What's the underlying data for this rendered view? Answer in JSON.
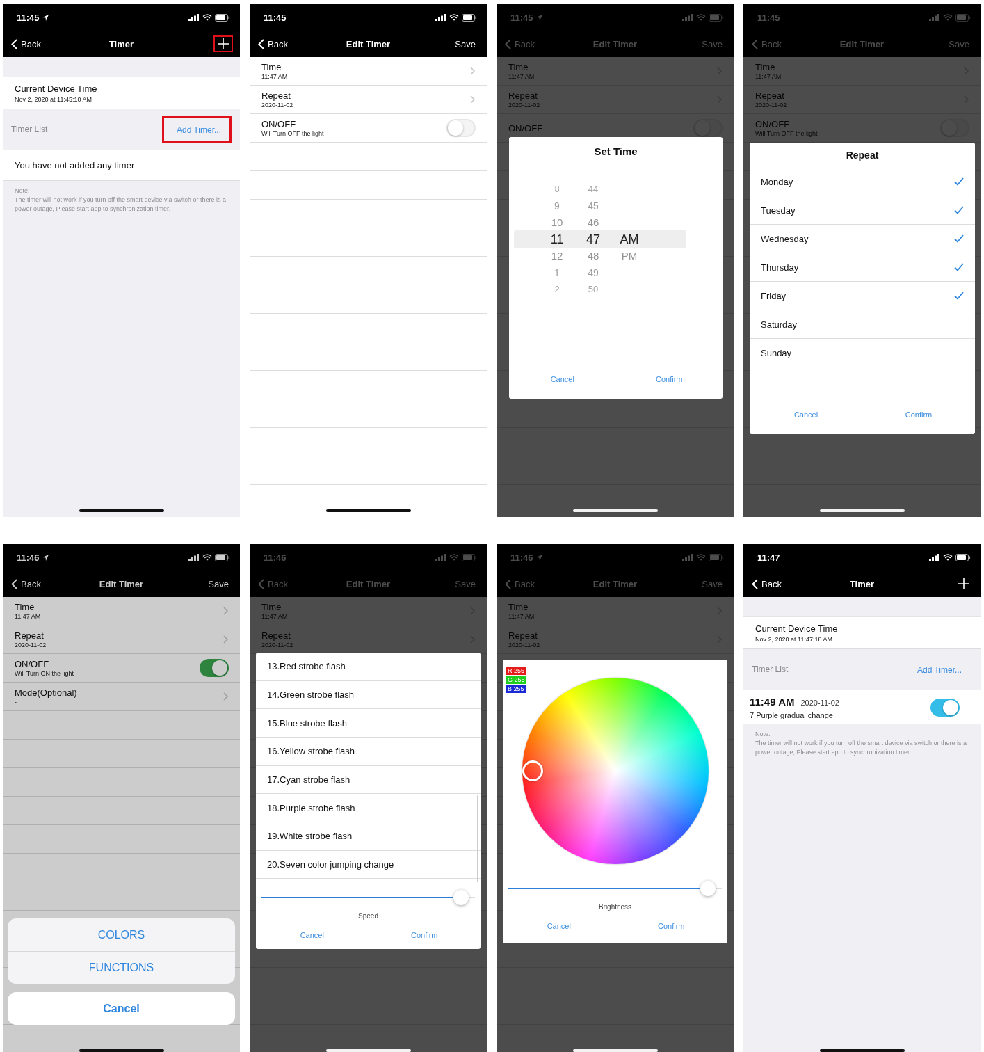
{
  "screens": [
    {
      "status_bar": {
        "time": "11:45",
        "location": true
      },
      "nav": {
        "back": "Back",
        "title": "Timer",
        "action": {
          "kind": "plus",
          "highlighted": true
        }
      },
      "content": {
        "kind": "timer_list",
        "device_time_label": "Current Device Time",
        "device_time": "Nov 2, 2020 at 11:45:10 AM",
        "list_label": "Timer List",
        "add_label": "Add Timer...",
        "add_highlighted": true,
        "empty_message": "You have not added any timer",
        "note_title": "Note:",
        "note": "The timer will not work if you turn off the smart device via switch or there is a power outage, Please start app to synchronization timer."
      }
    },
    {
      "status_bar": {
        "time": "11:45",
        "location": false
      },
      "nav": {
        "back": "Back",
        "title": "Edit Timer",
        "action": {
          "kind": "text",
          "label": "Save"
        }
      },
      "content": {
        "kind": "edit_timer",
        "rows": [
          {
            "title": "Time",
            "subtitle": "11:47 AM",
            "kind": "chevron"
          },
          {
            "title": "Repeat",
            "subtitle": "2020-11-02",
            "kind": "chevron"
          },
          {
            "title": "ON/OFF",
            "subtitle": "Will Turn OFF the light",
            "kind": "toggle",
            "on": false
          }
        ]
      }
    },
    {
      "status_bar": {
        "time": "11:45",
        "location": true
      },
      "nav": {
        "back": "Back",
        "title": "Edit Timer",
        "action": {
          "kind": "text",
          "label": "Save"
        }
      },
      "content": {
        "kind": "edit_timer",
        "rows": [
          {
            "title": "Time",
            "subtitle": "11:47 AM",
            "kind": "chevron"
          },
          {
            "title": "Repeat",
            "subtitle": "2020-11-02",
            "kind": "chevron"
          },
          {
            "title": "ON/OFF",
            "kind": "toggle",
            "on": false
          }
        ]
      },
      "overlay": {
        "kind": "time_picker",
        "title": "Set Time",
        "columns": [
          {
            "items": [
              {
                "label": "8",
                "selected": false
              },
              {
                "label": "9",
                "selected": false
              },
              {
                "label": "10",
                "selected": false
              },
              {
                "label": "11",
                "selected": true
              },
              {
                "label": "12",
                "selected": false
              },
              {
                "label": "1",
                "selected": false
              },
              {
                "label": "2",
                "selected": false
              }
            ]
          },
          {
            "items": [
              {
                "label": "44",
                "selected": false
              },
              {
                "label": "45",
                "selected": false
              },
              {
                "label": "46",
                "selected": false
              },
              {
                "label": "47",
                "selected": true
              },
              {
                "label": "48",
                "selected": false
              },
              {
                "label": "49",
                "selected": false
              },
              {
                "label": "50",
                "selected": false
              }
            ]
          },
          {
            "items": [
              {
                "label": "AM",
                "selected": true
              },
              {
                "label": "PM",
                "selected": false
              }
            ]
          }
        ],
        "cancel": "Cancel",
        "confirm": "Confirm"
      }
    },
    {
      "status_bar": {
        "time": "11:45",
        "location": false
      },
      "nav": {
        "back": "Back",
        "title": "Edit Timer",
        "action": {
          "kind": "text",
          "label": "Save"
        }
      },
      "content": {
        "kind": "edit_timer",
        "rows": [
          {
            "title": "Time",
            "subtitle": "11:47 AM",
            "kind": "chevron"
          },
          {
            "title": "Repeat",
            "subtitle": "2020-11-02",
            "kind": "chevron"
          },
          {
            "title": "ON/OFF",
            "subtitle": "Will Turn OFF the light",
            "kind": "toggle",
            "on": false
          }
        ]
      },
      "overlay": {
        "kind": "repeat",
        "title": "Repeat",
        "days": [
          {
            "label": "Monday",
            "checked": true
          },
          {
            "label": "Tuesday",
            "checked": true
          },
          {
            "label": "Wednesday",
            "checked": true
          },
          {
            "label": "Thursday",
            "checked": true
          },
          {
            "label": "Friday",
            "checked": true
          },
          {
            "label": "Saturday",
            "checked": false
          },
          {
            "label": "Sunday",
            "checked": false
          }
        ],
        "cancel": "Cancel",
        "confirm": "Confirm"
      }
    },
    {
      "status_bar": {
        "time": "11:46",
        "location": true
      },
      "nav": {
        "back": "Back",
        "title": "Edit Timer",
        "action": {
          "kind": "text",
          "label": "Save"
        }
      },
      "content": {
        "kind": "edit_timer",
        "rows": [
          {
            "title": "Time",
            "subtitle": "11:47 AM",
            "kind": "chevron"
          },
          {
            "title": "Repeat",
            "subtitle": "2020-11-02",
            "kind": "chevron"
          },
          {
            "title": "ON/OFF",
            "subtitle": "Will Turn ON the light",
            "kind": "toggle",
            "on": true
          },
          {
            "title": "Mode(Optional)",
            "subtitle": "-",
            "kind": "chevron"
          }
        ]
      },
      "overlay": {
        "kind": "action_sheet",
        "options": [
          "COLORS",
          "FUNCTIONS"
        ],
        "cancel": "Cancel"
      }
    },
    {
      "status_bar": {
        "time": "11:46",
        "location": false
      },
      "nav": {
        "back": "Back",
        "title": "Edit Timer",
        "action": {
          "kind": "text",
          "label": "Save"
        }
      },
      "content": {
        "kind": "edit_timer",
        "rows": [
          {
            "title": "Time",
            "subtitle": "11:47 AM",
            "kind": "chevron"
          },
          {
            "title": "Repeat",
            "subtitle": "2020-11-02",
            "kind": "chevron"
          }
        ]
      },
      "overlay": {
        "kind": "mode_list",
        "items": [
          "13.Red strobe flash",
          "14.Green strobe flash",
          "15.Blue strobe flash",
          "16.Yellow strobe flash",
          "17.Cyan strobe flash",
          "18.Purple strobe flash",
          "19.White strobe flash",
          "20.Seven color jumping change"
        ],
        "slider": {
          "level": 0.97,
          "label": "Speed"
        },
        "cancel": "Cancel",
        "confirm": "Confirm"
      }
    },
    {
      "status_bar": {
        "time": "11:46",
        "location": true
      },
      "nav": {
        "back": "Back",
        "title": "Edit Timer",
        "action": {
          "kind": "text",
          "label": "Save"
        }
      },
      "content": {
        "kind": "edit_timer",
        "rows": [
          {
            "title": "Time",
            "subtitle": "11:47 AM",
            "kind": "chevron"
          },
          {
            "title": "Repeat",
            "subtitle": "2020-11-02",
            "kind": "chevron"
          }
        ]
      },
      "overlay": {
        "kind": "color_wheel",
        "channels": [
          {
            "label": "R 255",
            "color": "#e51c1c"
          },
          {
            "label": "G 255",
            "color": "#1fcf1f"
          },
          {
            "label": "B 255",
            "color": "#1a2bd6"
          }
        ],
        "slider": {
          "level": 0.97,
          "label": "Brightness"
        },
        "cancel": "Cancel",
        "confirm": "Confirm"
      }
    },
    {
      "status_bar": {
        "time": "11:47",
        "location": false
      },
      "nav": {
        "back": "Back",
        "title": "Timer",
        "action": {
          "kind": "plus",
          "highlighted": false
        }
      },
      "content": {
        "kind": "timer_list",
        "device_time_label": "Current Device Time",
        "device_time": "Nov 2, 2020 at 11:47:18 AM",
        "list_label": "Timer List",
        "add_label": "Add Timer...",
        "add_highlighted": false,
        "timers": [
          {
            "time": "11:49 AM",
            "date": "2020-11-02",
            "mode": "7.Purple gradual change",
            "on": true
          }
        ],
        "note_title": "Note:",
        "note": "The timer will not work if you turn off the smart device via switch or there is a power outage, Please start app to synchronization timer."
      }
    }
  ]
}
